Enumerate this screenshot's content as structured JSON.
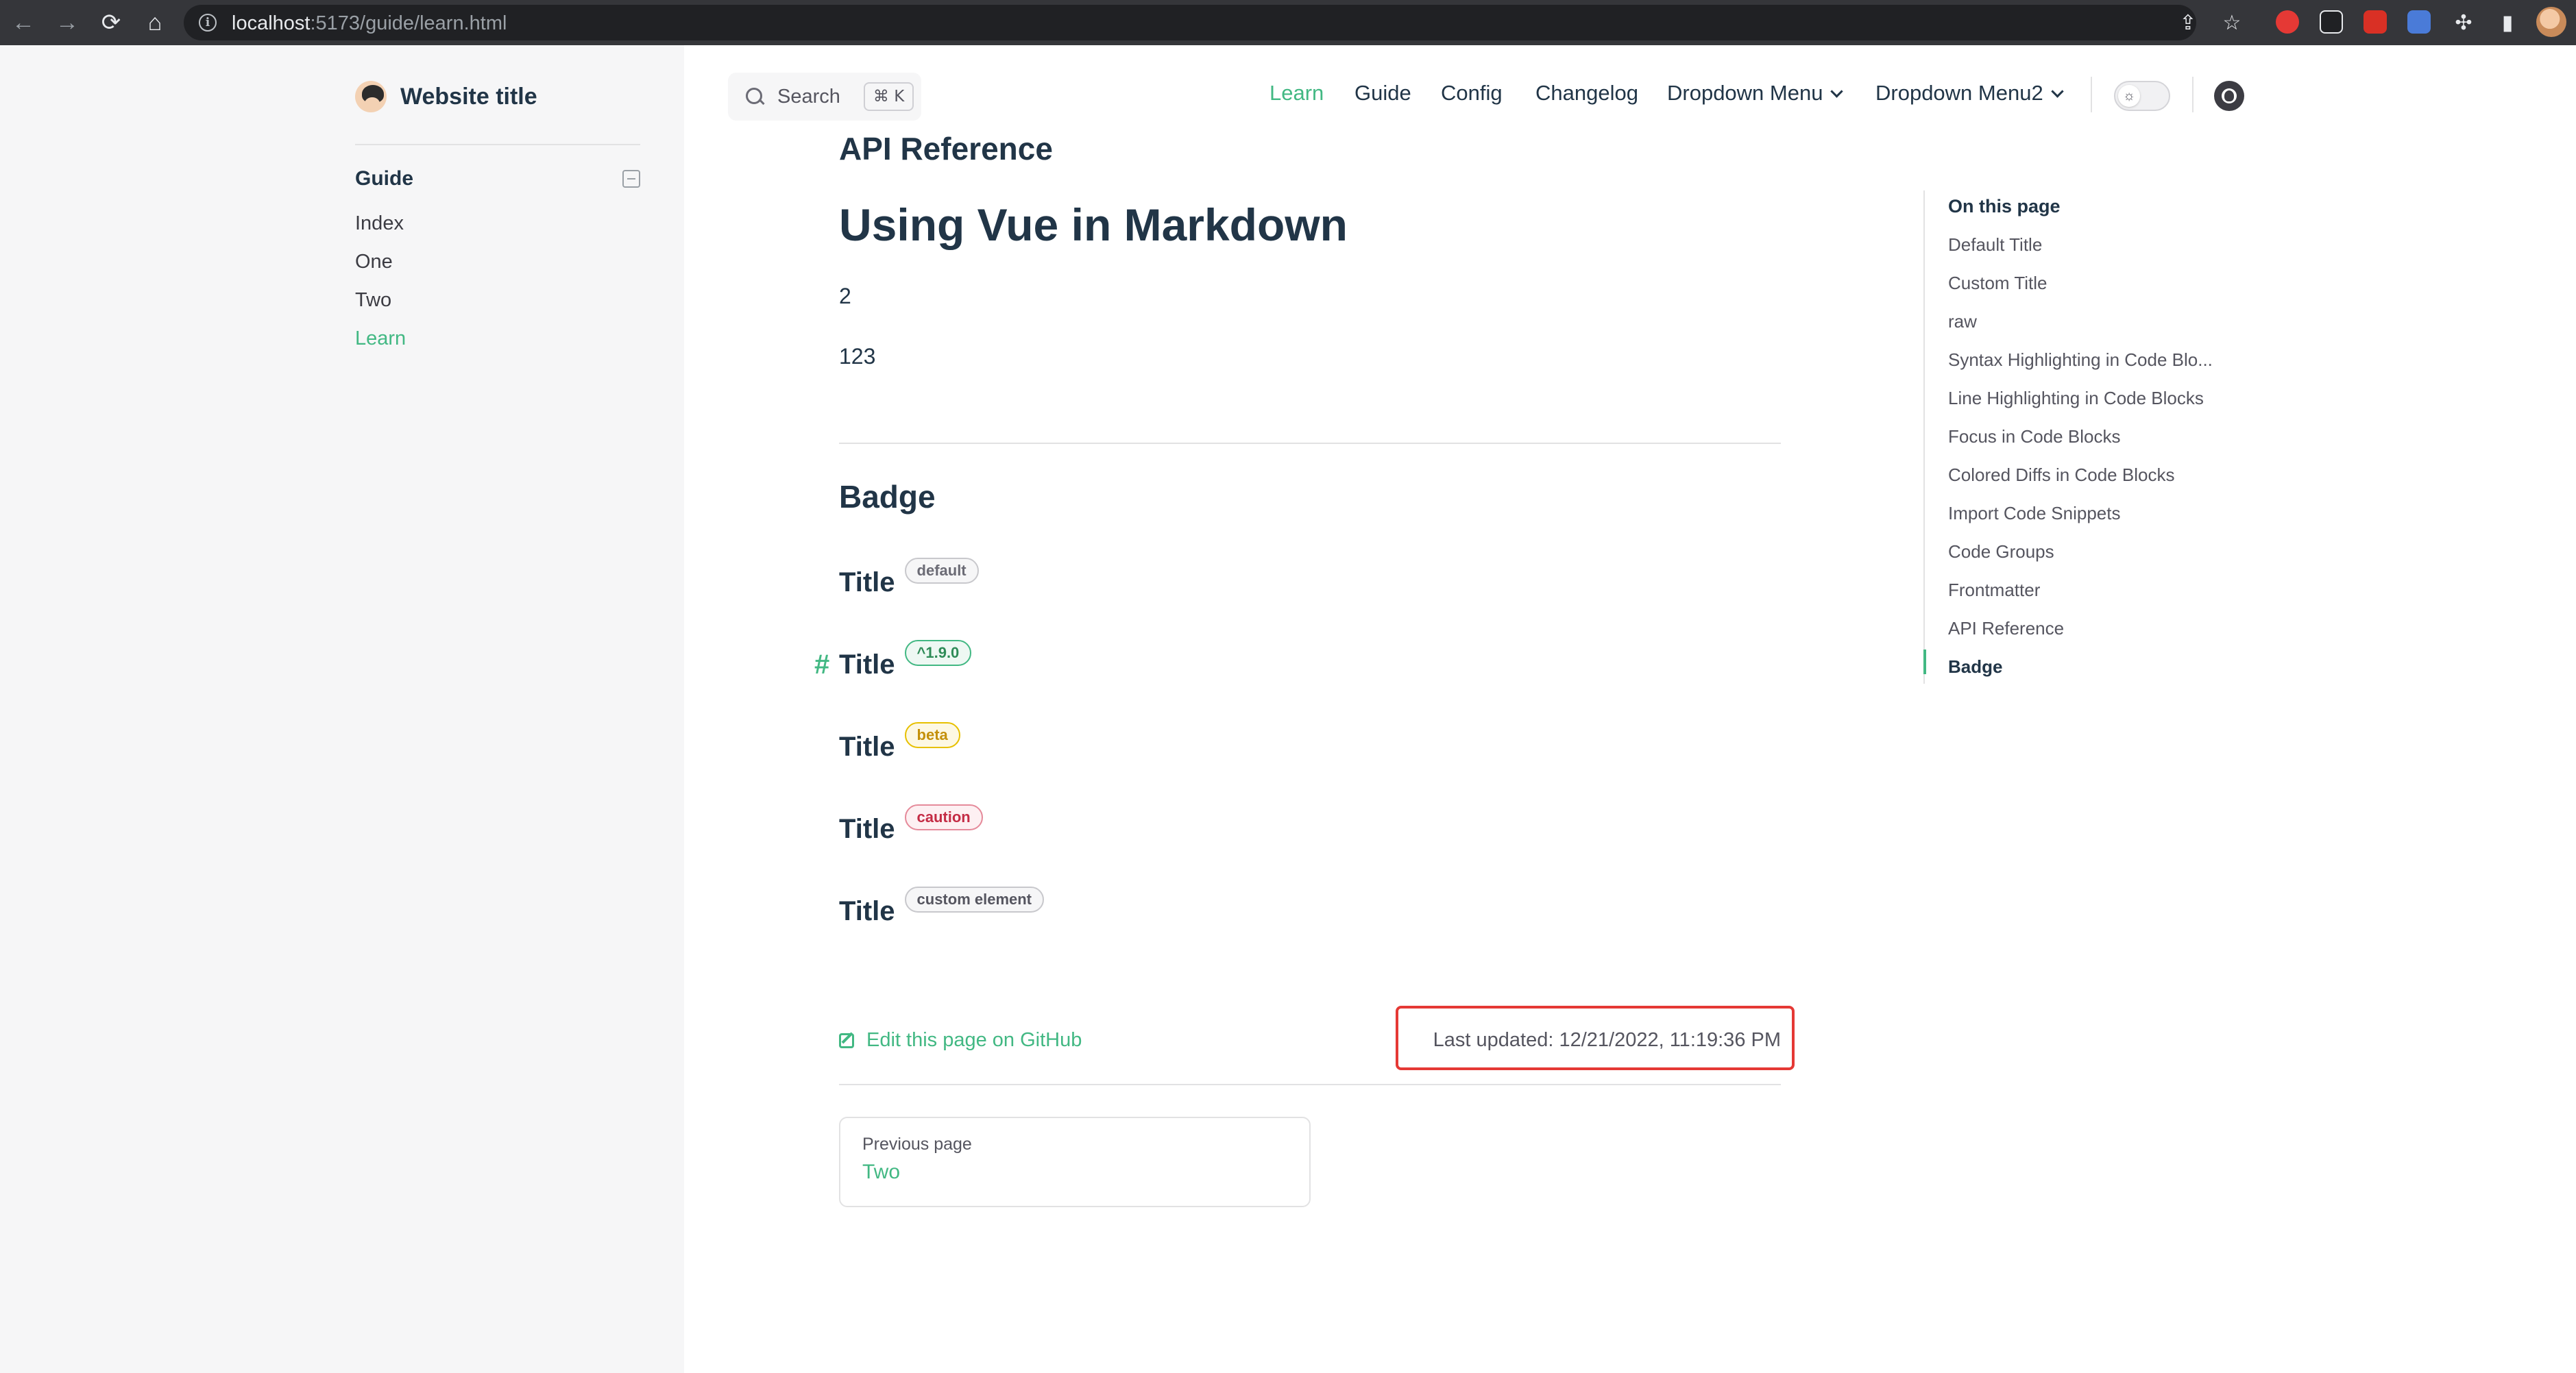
{
  "browser": {
    "url_host": "localhost",
    "url_path": ":5173/guide/learn.html",
    "info_icon": "info-icon",
    "icons": [
      "back-arrow-icon",
      "forward-arrow-icon",
      "reload-icon",
      "home-icon",
      "share-icon",
      "star-icon",
      "puzzle-icon",
      "sidepanel-icon"
    ]
  },
  "brand": {
    "title": "Website title"
  },
  "sidebar": {
    "group_title": "Guide",
    "items": [
      {
        "label": "Index",
        "active": false
      },
      {
        "label": "One",
        "active": false
      },
      {
        "label": "Two",
        "active": false
      },
      {
        "label": "Learn",
        "active": true
      }
    ]
  },
  "search": {
    "label": "Search",
    "shortcut": "⌘ K"
  },
  "nav": {
    "links": [
      "Learn",
      "Guide",
      "Config",
      "Changelog"
    ],
    "dropdowns": [
      "Dropdown Menu",
      "Dropdown Menu2"
    ],
    "active": "Learn"
  },
  "content": {
    "api_heading": "API Reference",
    "h1": "Using Vue in Markdown",
    "para1": "2",
    "para2": "123",
    "badge_heading": "Badge",
    "badge_rows": [
      {
        "title": "Title",
        "badge": "default"
      },
      {
        "title": "Title",
        "badge": "^1.9.0"
      },
      {
        "title": "Title",
        "badge": "beta"
      },
      {
        "title": "Title",
        "badge": "caution"
      },
      {
        "title": "Title",
        "badge": "custom element"
      }
    ],
    "anchor": "#"
  },
  "footer": {
    "edit_link": "Edit this page on GitHub",
    "last_updated": "Last updated: 12/21/2022, 11:19:36 PM",
    "prev_desc": "Previous page",
    "prev_title": "Two"
  },
  "outline": {
    "title": "On this page",
    "items": [
      "Default Title",
      "Custom Title",
      "raw",
      "Syntax Highlighting in Code Blo...",
      "Line Highlighting in Code Blocks",
      "Focus in Code Blocks",
      "Colored Diffs in Code Blocks",
      "Import Code Snippets",
      "Code Groups",
      "Frontmatter",
      "API Reference",
      "Badge"
    ],
    "active": "Badge"
  },
  "colors": {
    "brand": "#42b883",
    "text": "#213547",
    "highlight_box": "#e53935",
    "badge_default": "#6b6b75",
    "badge_tip": "#2e8b57",
    "badge_warning": "#c4900a",
    "badge_danger": "#c42c45"
  }
}
